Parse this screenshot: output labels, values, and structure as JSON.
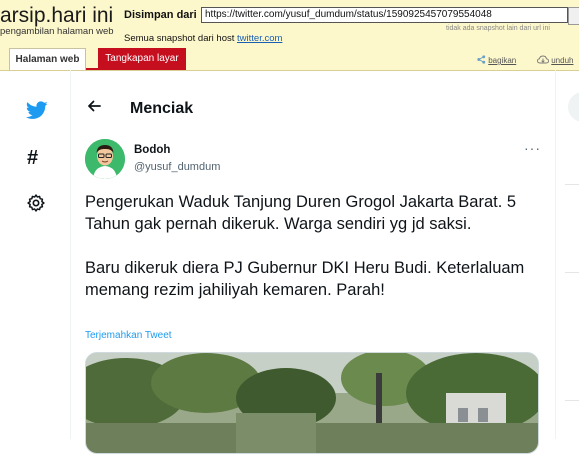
{
  "archive": {
    "logo": "arsip.hari ini",
    "logo_subtitle": "pengambilan halaman web",
    "saved_from_label": "Disimpan dari",
    "url": "https://twitter.com/yusuf_dumdum/status/1590925457079554048",
    "hint": "tidak ada snapshot lain dari url ini",
    "snapshots_label": "Semua snapshot dari host",
    "snapshots_host": "twitter.com",
    "tab_web": "Halaman web",
    "tab_screenshot": "Tangkapan layar",
    "share_label": "bagikan",
    "download_label": "unduh"
  },
  "twitter": {
    "header_title": "Menciak",
    "author_name": "Bodoh",
    "author_handle": "@yusuf_dumdum",
    "more": "···",
    "paragraphs": [
      "Pengerukan Waduk Tanjung Duren Grogol Jakarta Barat. 5 Tahun gak pernah dikeruk. Warga sendiri yg jd saksi.",
      "Baru dikeruk diera PJ Gubernur DKI Heru Budi. Keterlaluam memang rezim jahiliyah kemaren. Parah!"
    ],
    "translate": "Terjemahkan Tweet",
    "brand_color": "#1d9bf0"
  }
}
